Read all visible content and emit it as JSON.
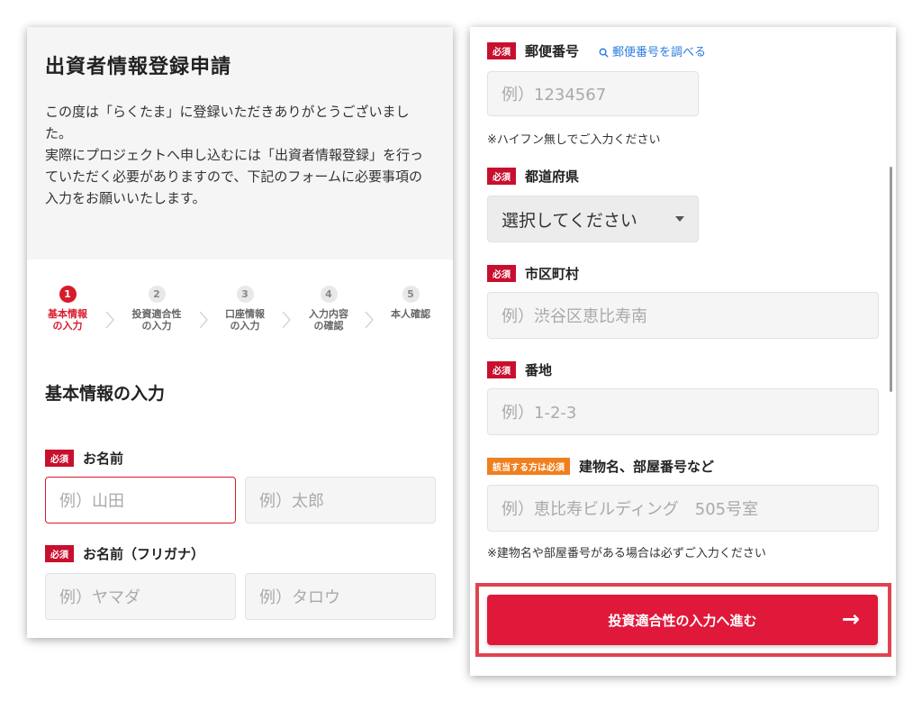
{
  "left": {
    "title": "出資者情報登録申請",
    "intro": "この度は「らくたま」に登録いただきありがとうございました。\n実際にプロジェクトへ申し込むには「出資者情報登録」を行っていただく必要がありますので、下記のフォームに必要事項の入力をお願いいたします。",
    "steps": [
      {
        "num": "1",
        "label": "基本情報\nの入力"
      },
      {
        "num": "2",
        "label": "投資適合性\nの入力"
      },
      {
        "num": "3",
        "label": "口座情報\nの入力"
      },
      {
        "num": "4",
        "label": "入力内容\nの確認"
      },
      {
        "num": "5",
        "label": "本人確認"
      }
    ],
    "section_title": "基本情報の入力",
    "required_badge": "必須",
    "name_label": "お名前",
    "last_name_placeholder": "例）山田",
    "first_name_placeholder": "例）太郎",
    "kana_label": "お名前（フリガナ）",
    "last_kana_placeholder": "例）ヤマダ",
    "first_kana_placeholder": "例）タロウ"
  },
  "right": {
    "required_badge": "必須",
    "zip_label": "郵便番号",
    "zip_link": "郵便番号を調べる",
    "zip_placeholder": "例）1234567",
    "zip_note": "※ハイフン無しでご入力ください",
    "pref_label": "都道府県",
    "pref_value": "選択してください",
    "city_label": "市区町村",
    "city_placeholder": "例）渋谷区恵比寿南",
    "street_label": "番地",
    "street_placeholder": "例）1-2-3",
    "optional_badge": "該当する方は必須",
    "building_label": "建物名、部屋番号など",
    "building_placeholder": "例）恵比寿ビルディング　505号室",
    "building_note": "※建物名や部屋番号がある場合は必ずご入力ください",
    "submit_label": "投資適合性の入力へ進む",
    "submit_arrow": "→"
  },
  "colors": {
    "accent": "#d81b2b",
    "button": "#e0183a",
    "optional_badge": "#f07f1e",
    "link": "#2a7de1"
  }
}
